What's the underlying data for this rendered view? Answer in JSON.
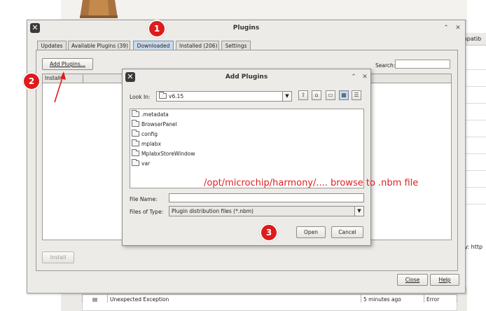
{
  "background": {
    "compat_header": "mpatib",
    "url_label": "ry: http",
    "table_row": {
      "message": "Unexpected Exception",
      "time": "5 minutes ago",
      "level": "Error"
    }
  },
  "plugins_dialog": {
    "title": "Plugins",
    "tabs": [
      {
        "label": "Updates"
      },
      {
        "label": "Available Plugins (39)"
      },
      {
        "label": "Downloaded"
      },
      {
        "label": "Installed (206)"
      },
      {
        "label": "Settings"
      }
    ],
    "active_tab": "Downloaded",
    "add_plugins_label": "Add Plugins...",
    "search_label": "Search:",
    "search_value": "",
    "table_columns": [
      "Install"
    ],
    "install_label": "Install",
    "close_label": "Close",
    "help_label": "Help"
  },
  "add_plugins_dialog": {
    "title": "Add Plugins",
    "look_in_label": "Look In:",
    "look_in_value": "v6.15",
    "files": [
      ".metadata",
      "BrowserPanel",
      "config",
      "mplabx",
      "MplabxStoreWindow",
      "var"
    ],
    "file_name_label": "File Name:",
    "file_name_value": "",
    "files_of_type_label": "Files of Type:",
    "files_of_type_value": "Plugin distribution files (*.nbm)",
    "open_label": "Open",
    "cancel_label": "Cancel"
  },
  "annotations": {
    "badge_1": "1",
    "badge_2": "2",
    "badge_3": "3",
    "note": "/opt/microchip/harmony/.... browse to .nbm file",
    "color": "#dd1c1c"
  },
  "icons": [
    "app-icon",
    "minimize-icon",
    "close-icon",
    "folder-icon",
    "combo-arrow-icon",
    "up-folder-icon",
    "home-icon",
    "new-folder-icon",
    "list-view-icon",
    "details-view-icon",
    "package-icon"
  ]
}
